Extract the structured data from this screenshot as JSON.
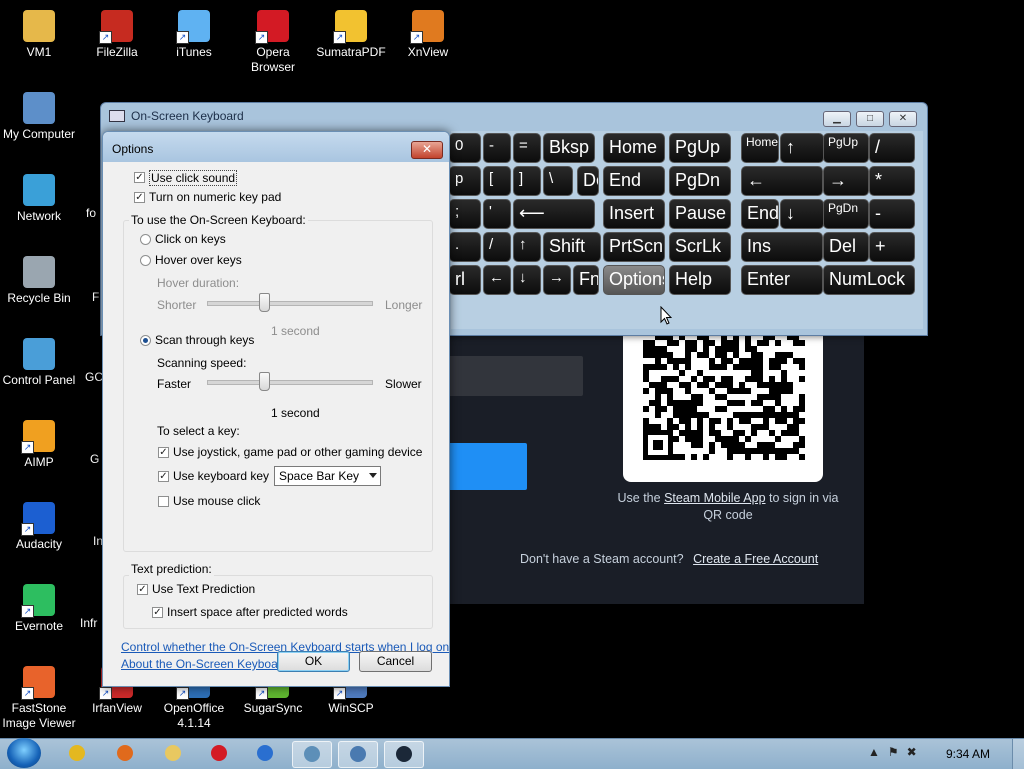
{
  "desktop": {
    "icons": [
      {
        "label": "VM1",
        "icon": "folder-icon",
        "color": "#e6b84a"
      },
      {
        "label": "FileZilla",
        "icon": "filezilla-icon",
        "color": "#c62b20"
      },
      {
        "label": "iTunes",
        "icon": "itunes-icon",
        "color": "#5fb2f2"
      },
      {
        "label": "Opera Browser",
        "icon": "opera-icon",
        "color": "#d31a24"
      },
      {
        "label": "SumatraPDF",
        "icon": "sumatrapdf-icon",
        "color": "#f2c230"
      },
      {
        "label": "XnView",
        "icon": "xnview-icon",
        "color": "#e07a1f"
      },
      {
        "label": "My Computer",
        "icon": "computer-icon",
        "color": "#5d8fc9"
      },
      {
        "label": "Network",
        "icon": "network-icon",
        "color": "#3aa0d8"
      },
      {
        "label": "Recycle Bin",
        "icon": "recycle-bin-icon",
        "color": "#9aa6b0"
      },
      {
        "label": "Control Panel",
        "icon": "control-panel-icon",
        "color": "#4a9ed8"
      },
      {
        "label": "AIMP",
        "icon": "aimp-icon",
        "color": "#f0a020"
      },
      {
        "label": "Audacity",
        "icon": "audacity-icon",
        "color": "#1c5fd1"
      },
      {
        "label": "Evernote",
        "icon": "evernote-icon",
        "color": "#2dbe60"
      },
      {
        "label": "FastStone Image Viewer",
        "icon": "faststone-icon",
        "color": "#e8632b"
      },
      {
        "label": "IrfanView",
        "icon": "irfanview-icon",
        "color": "#cc2a2a"
      },
      {
        "label": "OpenOffice 4.1.14",
        "icon": "openoffice-icon",
        "color": "#2d6fb6"
      },
      {
        "label": "SugarSync",
        "icon": "sugarsync-icon",
        "color": "#5fb630"
      },
      {
        "label": "WinSCP",
        "icon": "winscp-icon",
        "color": "#4f7cc0"
      }
    ],
    "partial_labels": [
      "fo",
      "F",
      "GC",
      "G",
      "In",
      "Infr"
    ]
  },
  "steam": {
    "qr_text_prefix": "Use the",
    "qr_link": "Steam Mobile App",
    "qr_text_suffix": "to sign in via QR code",
    "no_account_text": "Don't have a Steam account?",
    "create_account_link": "Create a Free Account"
  },
  "osk": {
    "title": "On-Screen Keyboard",
    "keys": [
      {
        "label": "0",
        "name": "key-0"
      },
      {
        "label": "-",
        "name": "key-minus"
      },
      {
        "label": "=",
        "name": "key-equals"
      },
      {
        "label": "Bksp",
        "name": "key-backspace"
      },
      {
        "label": "Home",
        "name": "key-home"
      },
      {
        "label": "PgUp",
        "name": "key-pgup"
      },
      {
        "label": "Home",
        "name": "numpad-home"
      },
      {
        "label": "↑",
        "name": "numpad-up"
      },
      {
        "label": "PgUp",
        "name": "numpad-pgup"
      },
      {
        "label": "/",
        "name": "numpad-divide"
      },
      {
        "label": "p",
        "name": "key-p"
      },
      {
        "label": "[",
        "name": "key-open-bracket"
      },
      {
        "label": "]",
        "name": "key-close-bracket"
      },
      {
        "label": "\\",
        "name": "key-backslash"
      },
      {
        "label": "Del",
        "name": "key-del"
      },
      {
        "label": "End",
        "name": "key-end"
      },
      {
        "label": "PgDn",
        "name": "key-pgdn"
      },
      {
        "label": "←",
        "name": "numpad-left"
      },
      {
        "label": "→",
        "name": "numpad-right"
      },
      {
        "label": "*",
        "name": "numpad-multiply"
      },
      {
        "label": ";",
        "name": "key-semicolon"
      },
      {
        "label": "'",
        "name": "key-quote"
      },
      {
        "label": "⟵",
        "name": "key-enter"
      },
      {
        "label": "Insert",
        "name": "key-insert"
      },
      {
        "label": "Pause",
        "name": "key-pause"
      },
      {
        "label": "End",
        "name": "numpad-end"
      },
      {
        "label": "↓",
        "name": "numpad-down"
      },
      {
        "label": "PgDn",
        "name": "numpad-pgdn"
      },
      {
        "label": "-",
        "name": "numpad-minus"
      },
      {
        "label": ".",
        "name": "key-period"
      },
      {
        "label": "/",
        "name": "key-slash"
      },
      {
        "label": "↑",
        "name": "key-up"
      },
      {
        "label": "Shift",
        "name": "key-shift"
      },
      {
        "label": "PrtScn",
        "name": "key-prtscn"
      },
      {
        "label": "ScrLk",
        "name": "key-scrlk"
      },
      {
        "label": "Ins",
        "name": "numpad-ins"
      },
      {
        "label": "Del",
        "name": "numpad-del"
      },
      {
        "label": "+",
        "name": "numpad-plus"
      },
      {
        "label": "rl",
        "name": "key-ctrl"
      },
      {
        "label": "←",
        "name": "key-left"
      },
      {
        "label": "↓",
        "name": "key-down"
      },
      {
        "label": "→",
        "name": "key-right"
      },
      {
        "label": "Fn",
        "name": "key-fn"
      },
      {
        "label": "Options",
        "name": "key-options"
      },
      {
        "label": "Help",
        "name": "key-help"
      },
      {
        "label": "Enter",
        "name": "numpad-enter"
      },
      {
        "label": "NumLock",
        "name": "key-numlock"
      }
    ]
  },
  "options": {
    "title": "Options",
    "use_click_sound": "Use click sound",
    "numeric_key_pad": "Turn on numeric key pad",
    "group_title": "To use the On-Screen Keyboard:",
    "click_on_keys": "Click on keys",
    "hover_over_keys": "Hover over keys",
    "hover_duration": "Hover duration:",
    "shorter": "Shorter",
    "longer": "Longer",
    "hover_value": "1 second",
    "hover_level": 0.35,
    "scan_through_keys": "Scan through keys",
    "scanning_speed": "Scanning speed:",
    "faster": "Faster",
    "slower": "Slower",
    "scan_value": "1 second",
    "scan_level": 0.35,
    "to_select_key": "To select a key:",
    "use_joystick": "Use joystick, game pad or other gaming device",
    "use_keyboard_key": "Use keyboard key",
    "keyboard_key_value": "Space Bar Key",
    "use_mouse_click": "Use mouse click",
    "text_prediction_title": "Text prediction:",
    "use_text_prediction": "Use Text Prediction",
    "insert_space": "Insert space after predicted words",
    "link_logon": "Control whether the On-Screen Keyboard starts when I log on",
    "link_about": "About the On-Screen Keyboard",
    "ok": "OK",
    "cancel": "Cancel"
  },
  "taskbar": {
    "time": "9:34 AM",
    "buttons": [
      {
        "name": "chrome-taskbar-button",
        "color": "#e4b820"
      },
      {
        "name": "firefox-taskbar-button",
        "color": "#e06a1c"
      },
      {
        "name": "explorer-taskbar-button",
        "color": "#e8c860"
      },
      {
        "name": "opera-taskbar-button",
        "color": "#d31a24"
      },
      {
        "name": "app-taskbar-button",
        "color": "#2a6fd0"
      },
      {
        "name": "tool-taskbar-button",
        "color": "#5d8fb8"
      },
      {
        "name": "osk-taskbar-button",
        "color": "#4a7ab0"
      },
      {
        "name": "steam-taskbar-button",
        "color": "#1b2838"
      }
    ]
  }
}
